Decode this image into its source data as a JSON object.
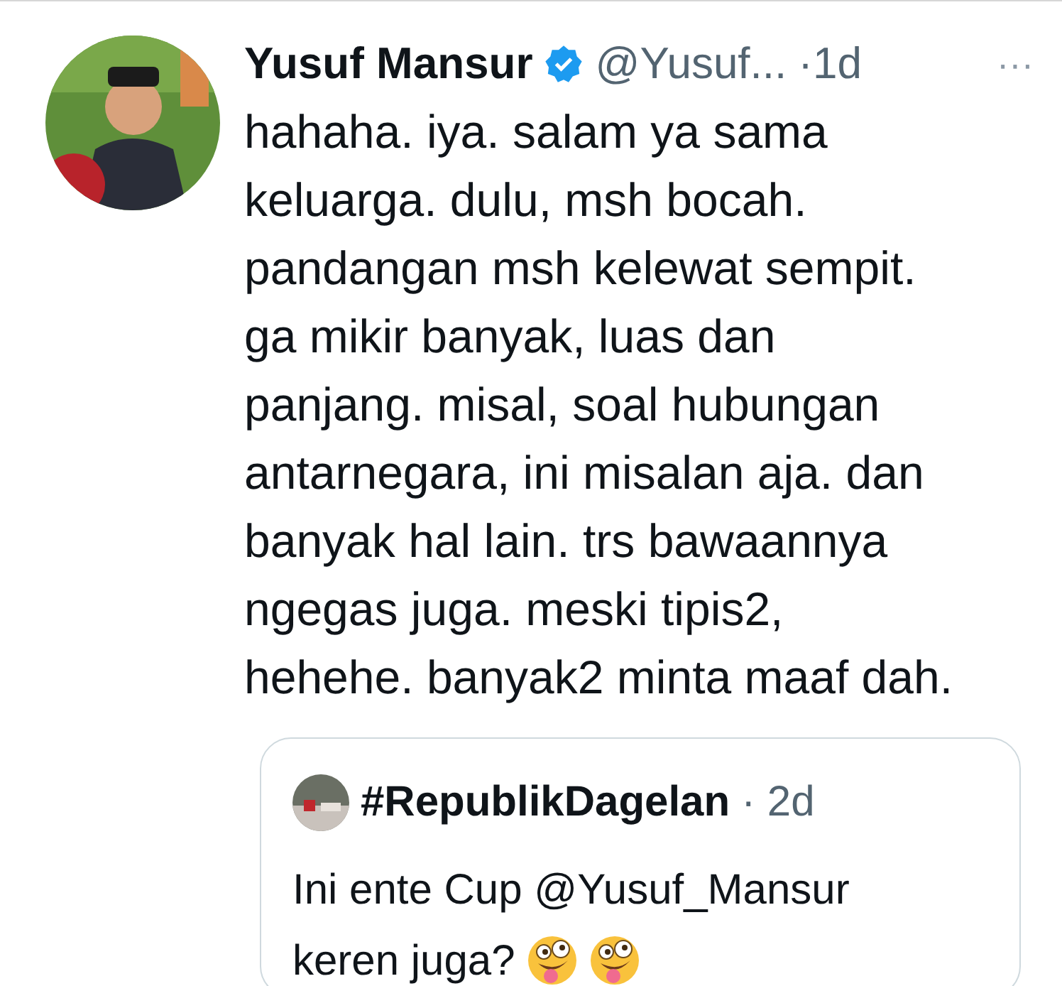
{
  "tweet": {
    "author": "Yusuf Mansur",
    "verified": true,
    "handle": "@Yusuf...",
    "time": "·1d",
    "more": "···",
    "body": "hahaha. iya. salam ya sama\nkeluarga. dulu, msh bocah.\npandangan msh kelewat sempit.\nga mikir banyak, luas dan\npanjang. misal, soal hubungan\nantarnegara, ini misalan aja. dan\nbanyak hal lain. trs bawaannya\nngegas juga. meski tipis2,\nhehehe. banyak2 minta maaf dah.",
    "quote": {
      "author": "#RepublikDagelan",
      "time": "· 2d",
      "lines": [
        "Ini ente Cup @Yusuf_Mansur",
        "keren juga?"
      ],
      "emoji": [
        {
          "kind": "zany"
        },
        {
          "kind": "zany"
        }
      ]
    }
  }
}
